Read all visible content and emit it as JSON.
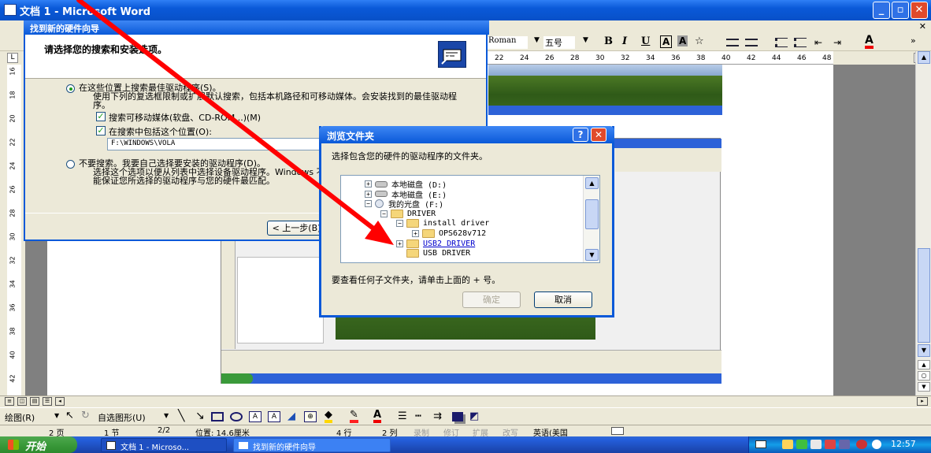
{
  "word": {
    "title": "文档 1 - Microsoft Word",
    "font_name": "Roman",
    "font_size": "五号",
    "fmt_buttons": [
      "B",
      "I",
      "U",
      "A",
      "A",
      "☆"
    ],
    "ruler_numbers": [
      "22",
      "24",
      "26",
      "28",
      "30",
      "32",
      "34",
      "36",
      "38",
      "40",
      "42",
      "44",
      "46",
      "48"
    ],
    "vruler_numbers": [
      "16",
      "18",
      "20",
      "22",
      "24",
      "26",
      "28",
      "30",
      "32",
      "34",
      "36",
      "38",
      "40",
      "42"
    ],
    "draw_label": "绘图(R)",
    "autoshape_label": "自选图形(U)",
    "status": {
      "page": "2 页",
      "section": "1 节",
      "pos": "2/2",
      "at": "位置: 14.6厘米",
      "ln": "4 行",
      "col": "2 列",
      "rec": "录制",
      "trk": "修订",
      "ext": "扩展",
      "ovr": "改写",
      "lang": "英语(美国"
    }
  },
  "wizard": {
    "title": "找到新的硬件向导",
    "heading": "请选择您的搜索和安装选项。",
    "opt1_label": "在这些位置上搜索最佳驱动程序(S)。",
    "opt1_desc": "使用下列的复选框限制或扩展默认搜索，包括本机路径和可移动媒体。会安装找到的最佳驱动程序。",
    "chk1_label": "搜索可移动媒体(软盘、CD-ROM...)(M)",
    "chk2_label": "在搜索中包括这个位置(O):",
    "path_value": "F:\\WINDOWS\\VOLA",
    "opt2_label": "不要搜索。我要自己选择要安装的驱动程序(D)。",
    "opt2_desc": "选择这个选项以便从列表中选择设备驱动程序。Windows 不能保证您所选择的驱动程序与您的硬件最匹配。",
    "back_button": "< 上一步(B)"
  },
  "browse": {
    "title": "浏览文件夹",
    "instruction": "选择包含您的硬件的驱动程序的文件夹。",
    "tree": [
      {
        "label": "本地磁盘  (D:)",
        "type": "drive",
        "pm": "+"
      },
      {
        "label": "本地磁盘  (E:)",
        "type": "drive",
        "pm": "+"
      },
      {
        "label": "我的光盘  (F:)",
        "type": "cd",
        "pm": "−"
      },
      {
        "label": "DRIVER",
        "type": "folder",
        "pm": "−"
      },
      {
        "label": "install driver",
        "type": "folder",
        "pm": "−"
      },
      {
        "label": "OPS628v712",
        "type": "folder",
        "pm": "+"
      },
      {
        "label": "USB2 DRIVER",
        "type": "folder",
        "pm": "+"
      },
      {
        "label": "USB  DRIVER",
        "type": "folder",
        "pm": ""
      }
    ],
    "hint": "要查看任何子文件夹，请单击上面的 + 号。",
    "ok_button": "确定",
    "cancel_button": "取消"
  },
  "taskbar": {
    "start": "开始",
    "items": [
      "文档 1 - Microso...",
      "找到新的硬件向导"
    ],
    "clock": "12:57"
  },
  "colors": {
    "xp_blue": "#0a59d8",
    "arrow_red": "#ff0000",
    "start_green": "#3a9a3a"
  }
}
